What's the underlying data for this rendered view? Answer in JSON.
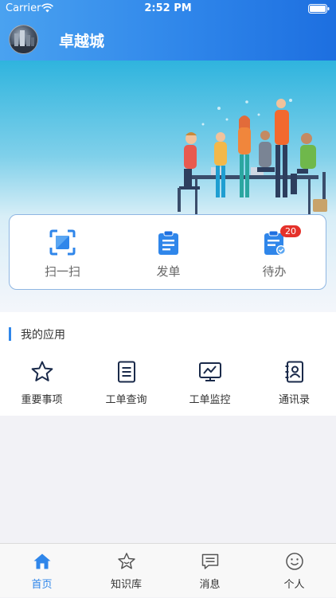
{
  "status_bar": {
    "carrier": "Carrier",
    "time": "2:52 PM"
  },
  "header": {
    "title": "卓越城"
  },
  "quick_actions": [
    {
      "label": "扫一扫",
      "icon": "scan-icon"
    },
    {
      "label": "发单",
      "icon": "clipboard-icon"
    },
    {
      "label": "待办",
      "icon": "todo-icon",
      "badge": "20"
    }
  ],
  "apps": {
    "title": "我的应用",
    "items": [
      {
        "label": "重要事项",
        "icon": "star-icon"
      },
      {
        "label": "工单查询",
        "icon": "document-list-icon"
      },
      {
        "label": "工单监控",
        "icon": "monitor-chart-icon"
      },
      {
        "label": "通讯录",
        "icon": "contacts-icon"
      }
    ]
  },
  "tab_bar": [
    {
      "label": "首页",
      "icon": "home-icon",
      "active": true
    },
    {
      "label": "知识库",
      "icon": "star-outline-icon",
      "active": false
    },
    {
      "label": "消息",
      "icon": "message-icon",
      "active": false
    },
    {
      "label": "个人",
      "icon": "smiley-icon",
      "active": false
    }
  ],
  "colors": {
    "accent": "#2f86ea",
    "badge": "#e5312a",
    "icon_dark": "#1a2a4a"
  }
}
